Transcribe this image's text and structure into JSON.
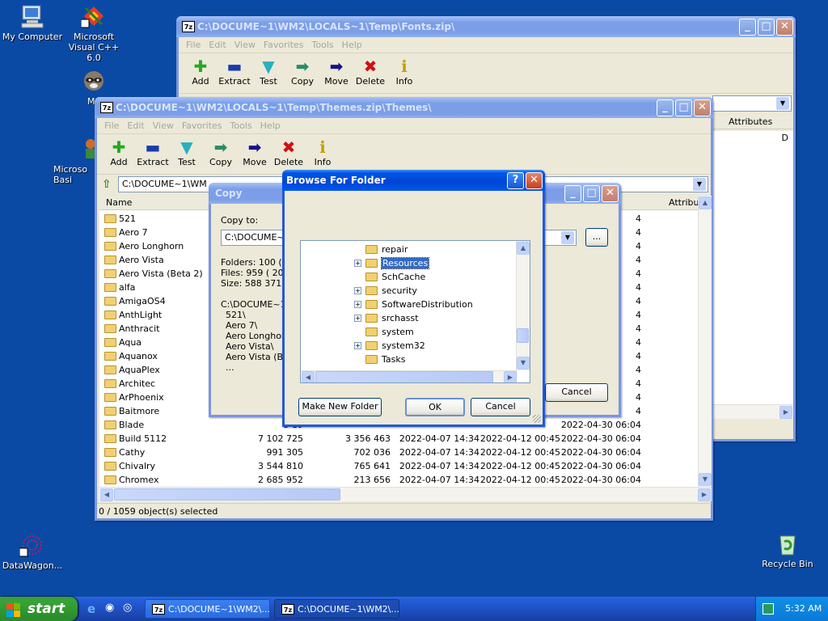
{
  "desktop": {
    "icons": [
      {
        "label": "My Computer"
      },
      {
        "label": "Microsoft Visual C++ 6.0"
      },
      {
        "label": "My"
      },
      {
        "label": "Microso Basi"
      },
      {
        "label": "DataWagon..."
      },
      {
        "label": "Recycle Bin"
      }
    ]
  },
  "menu": [
    "File",
    "Edit",
    "View",
    "Favorites",
    "Tools",
    "Help"
  ],
  "tools": [
    "Add",
    "Extract",
    "Test",
    "Copy",
    "Move",
    "Delete",
    "Info"
  ],
  "fonts_window": {
    "title": "C:\\DOCUME~1\\WM2\\LOCALS~1\\Temp\\Fonts.zip\\",
    "attributes_header": "Attributes",
    "attr_value": "D"
  },
  "themes_window": {
    "title": "C:\\DOCUME~1\\WM2\\LOCALS~1\\Temp\\Themes.zip\\Themes\\",
    "address": "C:\\DOCUME~1\\WM",
    "col_name": "Name",
    "col_attr": "Attribu",
    "status": "0 / 1059 object(s) selected",
    "rows": [
      {
        "name": "521",
        "size": "",
        "packed": "",
        "modified": "",
        "created": "",
        "accessed": "4"
      },
      {
        "name": "Aero 7",
        "size": "",
        "packed": "",
        "modified": "",
        "created": "",
        "accessed": "4"
      },
      {
        "name": "Aero Longhorn",
        "size": "",
        "packed": "",
        "modified": "",
        "created": "",
        "accessed": "4"
      },
      {
        "name": "Aero Vista",
        "size": "",
        "packed": "",
        "modified": "",
        "created": "",
        "accessed": "4"
      },
      {
        "name": "Aero Vista (Beta 2)",
        "size": "",
        "packed": "",
        "modified": "",
        "created": "",
        "accessed": "4"
      },
      {
        "name": "alfa",
        "size": "",
        "packed": "",
        "modified": "",
        "created": "",
        "accessed": "4"
      },
      {
        "name": "AmigaOS4",
        "size": "",
        "packed": "",
        "modified": "",
        "created": "",
        "accessed": "4"
      },
      {
        "name": "AnthLight",
        "size": "",
        "packed": "",
        "modified": "",
        "created": "",
        "accessed": "4"
      },
      {
        "name": "Anthracit",
        "size": "",
        "packed": "",
        "modified": "",
        "created": "",
        "accessed": "4"
      },
      {
        "name": "Aqua",
        "size": "",
        "packed": "",
        "modified": "",
        "created": "",
        "accessed": "4"
      },
      {
        "name": "Aquanox",
        "size": "",
        "packed": "",
        "modified": "",
        "created": "",
        "accessed": "4"
      },
      {
        "name": "AquaPlex",
        "size": "",
        "packed": "",
        "modified": "",
        "created": "",
        "accessed": "4"
      },
      {
        "name": "Architec",
        "size": "",
        "packed": "",
        "modified": "",
        "created": "",
        "accessed": "4"
      },
      {
        "name": "ArPhoenix",
        "size": "",
        "packed": "",
        "modified": "",
        "created": "",
        "accessed": "4"
      },
      {
        "name": "Baitmore",
        "size": "",
        "packed": "",
        "modified": "",
        "created": "",
        "accessed": "4"
      },
      {
        "name": "Blade",
        "size": "3 19",
        "packed": "",
        "modified": "",
        "created": "",
        "accessed": "2022-04-30 06:04"
      },
      {
        "name": "Build 5112",
        "size": "7 102 725",
        "packed": "3 356 463",
        "modified": "2022-04-07 14:34",
        "created": "2022-04-12 00:45",
        "accessed": "2022-04-30 06:04"
      },
      {
        "name": "Cathy",
        "size": "991 305",
        "packed": "702 036",
        "modified": "2022-04-07 14:34",
        "created": "2022-04-12 00:45",
        "accessed": "2022-04-30 06:04"
      },
      {
        "name": "Chivalry",
        "size": "3 544 810",
        "packed": "765 641",
        "modified": "2022-04-07 14:34",
        "created": "2022-04-12 00:45",
        "accessed": "2022-04-30 06:04"
      },
      {
        "name": "Chromex",
        "size": "2 685 952",
        "packed": "213 656",
        "modified": "2022-04-07 14:34",
        "created": "2022-04-12 00:45",
        "accessed": "2022-04-30 06:04"
      }
    ]
  },
  "copy_dialog": {
    "title": "Copy",
    "copy_to_label": "Copy to:",
    "path_value": "C:\\DOCUME~1",
    "browse_label": "...",
    "stats": [
      "Folders: 100   (",
      "Files: 959    ( 20",
      "Size: 588 371 50"
    ],
    "items": [
      "C:\\DOCUME~1\\",
      "521\\",
      "Aero 7\\",
      "Aero Longhorn",
      "Aero Vista\\",
      "Aero Vista (Bet",
      "..."
    ],
    "cancel_label": "Cancel"
  },
  "browse_dialog": {
    "title": "Browse For Folder",
    "help_label": "?",
    "tree": [
      {
        "label": "repair",
        "plus": false,
        "selected": false
      },
      {
        "label": "Resources",
        "plus": true,
        "selected": true
      },
      {
        "label": "SchCache",
        "plus": false,
        "selected": false
      },
      {
        "label": "security",
        "plus": true,
        "selected": false
      },
      {
        "label": "SoftwareDistribution",
        "plus": true,
        "selected": false
      },
      {
        "label": "srchasst",
        "plus": true,
        "selected": false
      },
      {
        "label": "system",
        "plus": false,
        "selected": false
      },
      {
        "label": "system32",
        "plus": true,
        "selected": false
      },
      {
        "label": "Tasks",
        "plus": false,
        "selected": false
      }
    ],
    "make_new_folder_label": "Make New Folder",
    "ok_label": "OK",
    "cancel_label": "Cancel"
  },
  "taskbar": {
    "start_label": "start",
    "tasks": [
      {
        "label": "C:\\DOCUME~1\\WM2\\..."
      },
      {
        "label": "C:\\DOCUME~1\\WM2\\..."
      }
    ],
    "clock": "5:32 AM"
  }
}
